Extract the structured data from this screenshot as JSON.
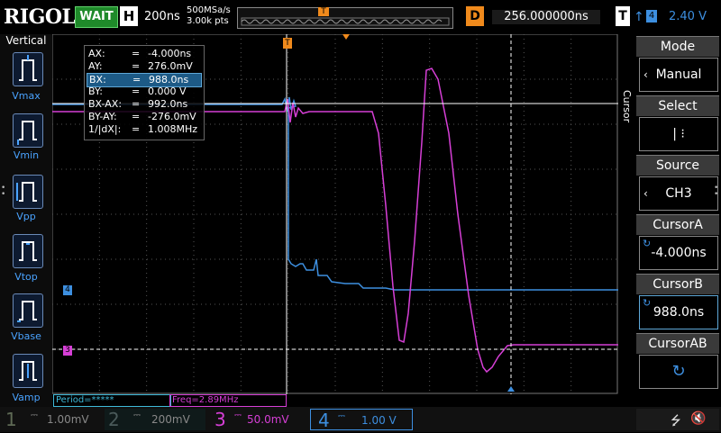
{
  "topbar": {
    "logo": "RIGOL",
    "status": "WAIT",
    "h_label": "H",
    "timebase": "200ns",
    "sample_rate": "500MSa/s",
    "memory_depth": "3.00k pts",
    "trigger_marker": "T",
    "delay_label": "D",
    "delay_value": "256.000000ns",
    "trig_label": "T",
    "trig_source": "4",
    "trig_level": "2.40 V"
  },
  "left_panel": {
    "title": "Vertical",
    "items": [
      {
        "label": "Vmax"
      },
      {
        "label": "Vmin"
      },
      {
        "label": "Vpp"
      },
      {
        "label": "Vtop"
      },
      {
        "label": "Vbase"
      },
      {
        "label": "Vamp"
      }
    ]
  },
  "cursor_readout": {
    "rows": [
      {
        "label": "AX:",
        "value": "-4.000ns"
      },
      {
        "label": "AY:",
        "value": "276.0mV"
      },
      {
        "label": "BX:",
        "value": "988.0ns"
      },
      {
        "label": "BY:",
        "value": "0.000 V"
      },
      {
        "label": "BX-AX:",
        "value": "992.0ns"
      },
      {
        "label": "BY-AY:",
        "value": "-276.0mV"
      },
      {
        "label": "1/|dX|:",
        "value": "1.008MHz"
      }
    ],
    "eq": "="
  },
  "markers": {
    "ch4": "4",
    "ch3": "3",
    "trig_level": "T"
  },
  "right_panel": {
    "tab_label": "Cursor",
    "mode": {
      "title": "Mode",
      "value": "Manual"
    },
    "select": {
      "title": "Select",
      "value": "| ⁝"
    },
    "source": {
      "title": "Source",
      "value": "CH3"
    },
    "cursor_a": {
      "title": "CursorA",
      "value": "-4.000ns"
    },
    "cursor_b": {
      "title": "CursorB",
      "value": "988.0ns"
    },
    "cursor_ab": {
      "title": "CursorAB",
      "value": ""
    }
  },
  "measure_bar": {
    "period": "Period=*****",
    "freq": "Freq=2.89MHz"
  },
  "bottom_bar": {
    "channels": [
      {
        "num": "1",
        "scale": "1.00mV",
        "color": "#5f6a55"
      },
      {
        "num": "2",
        "scale": "200mV",
        "color": "#4a5a5a"
      },
      {
        "num": "3",
        "scale": "50.0mV",
        "color": "#d63fd6"
      },
      {
        "num": "4",
        "scale": "1.00 V",
        "color": "#3d8fe0"
      }
    ]
  },
  "colors": {
    "ch3": "#d63fd6",
    "ch4": "#3d8fe0",
    "accent": "#f08a1c",
    "grid": "#555555"
  }
}
